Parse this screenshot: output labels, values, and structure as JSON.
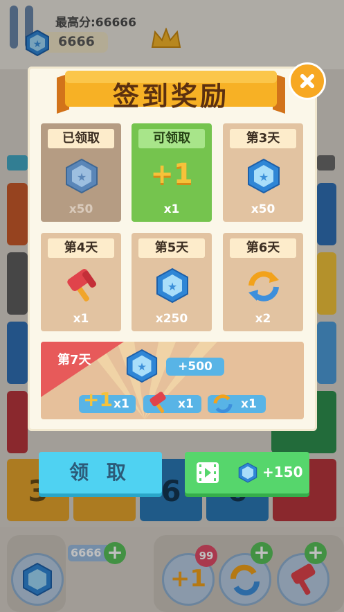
{
  "hud": {
    "best_score": "最高分:66666",
    "coins": "6666"
  },
  "board": {
    "tiles": [
      "6",
      "3",
      "6",
      "6",
      "3"
    ]
  },
  "dialog": {
    "title": "签到奖励",
    "days": [
      {
        "label": "已领取",
        "amount": "x50",
        "icon": "gem-icon",
        "state": "claimed"
      },
      {
        "label": "可领取",
        "amount": "x1",
        "icon": "plus-one-icon",
        "state": "available"
      },
      {
        "label": "第3天",
        "amount": "x50",
        "icon": "gem-icon",
        "state": "locked"
      },
      {
        "label": "第4天",
        "amount": "x1",
        "icon": "hammer-icon",
        "state": "locked"
      },
      {
        "label": "第5天",
        "amount": "x250",
        "icon": "gem-icon",
        "state": "locked"
      },
      {
        "label": "第6天",
        "amount": "x2",
        "icon": "shuffle-icon",
        "state": "locked"
      }
    ],
    "day7": {
      "label": "第7天",
      "gems": "+500",
      "items": [
        {
          "icon": "plus-one-icon",
          "glyph": "+1",
          "amount": "x1"
        },
        {
          "icon": "hammer-icon",
          "amount": "x1"
        },
        {
          "icon": "shuffle-icon",
          "amount": "x1"
        }
      ]
    },
    "claim_label": "领 取",
    "video_bonus": "+150"
  },
  "bottom": {
    "coins": "6666",
    "plus_one_glyph": "+1",
    "badge": "99"
  },
  "colors": {
    "claimed": "#b59c83",
    "available": "#75c44e",
    "locked": "#e2c3a1",
    "claim_button": "#4fd2f2",
    "video_button": "#56d66c",
    "close_button": "#f7a823"
  }
}
